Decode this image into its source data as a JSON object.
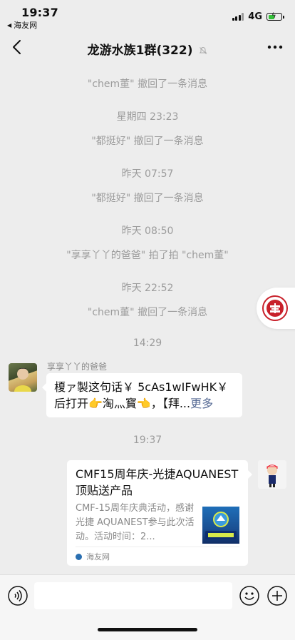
{
  "status_bar": {
    "time": "19:37",
    "back_app": "海友网",
    "network": "4G"
  },
  "nav": {
    "title": "龙游水族1群(322)"
  },
  "system_messages": [
    "\"chem董\" 撤回了一条消息",
    "星期四 23:23",
    "\"都挺好\" 撤回了一条消息",
    "昨天 07:57",
    "\"都挺好\" 撤回了一条消息",
    "昨天 08:50",
    "\"享享丫丫的爸爸\" 拍了拍 \"chem董\"",
    "昨天 22:52",
    "\"chem董\" 撤回了一条消息",
    "14:29",
    "19:37"
  ],
  "messages": {
    "incoming": {
      "sender": "享享丫丫的爸爸",
      "line1": "榎ァ製这句话￥ 5cAs1wIFwHK￥",
      "line2": "后打开👉淘灬寳👈，【拜...",
      "more": "更多"
    },
    "card": {
      "title": "CMF15周年庆-光捷AQUANEST顶贴送产品",
      "description": "CMF-15周年庆典活动，感谢光捷 AQUANEST参与此次活动。活动时间：2...",
      "source": "海友网"
    }
  },
  "colors": {
    "background": "#ededed",
    "link": "#576b95",
    "battery": "#35c23a"
  },
  "icons": [
    "back-chevron-icon",
    "mute-bell-icon",
    "more-dots-icon",
    "voice-icon",
    "emoji-icon",
    "plus-icon"
  ]
}
